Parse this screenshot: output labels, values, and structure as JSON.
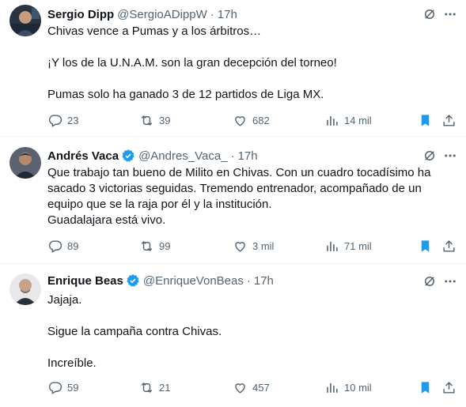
{
  "tweets": [
    {
      "name": "Sergio Dipp",
      "verified": false,
      "handle": "@SergioADippW",
      "dot": "·",
      "time": "17h",
      "lines": [
        "Chivas vence a Pumas y a los árbitros…",
        "",
        "¡Y los de la U.N.A.M. son la gran decepción del torneo!",
        "",
        "Pumas solo ha ganado 3 de 12 partidos de Liga MX."
      ],
      "replies": "23",
      "retweets": "39",
      "likes": "682",
      "views": "14 mil",
      "bookmarked": true
    },
    {
      "name": "Andrés Vaca",
      "verified": true,
      "handle": "@Andres_Vaca_",
      "dot": "·",
      "time": "17h",
      "lines": [
        "Que trabajo tan bueno de Milito en Chivas. Con un cuadro tocadísimo ha",
        "sacado 3 victorias seguidas. Tremendo entrenador, acompañado de un",
        "equipo que se la raja por él y la institución.",
        "Guadalajara está vivo."
      ],
      "replies": "89",
      "retweets": "99",
      "likes": "3 mil",
      "views": "71 mil",
      "bookmarked": true
    },
    {
      "name": "Enrique Beas",
      "verified": true,
      "handle": "@EnriqueVonBeas",
      "dot": "·",
      "time": "17h",
      "lines": [
        "Jajaja.",
        "",
        "Sigue la campaña contra Chivas.",
        "",
        "Increíble."
      ],
      "replies": "59",
      "retweets": "21",
      "likes": "457",
      "views": "10 mil",
      "bookmarked": true
    }
  ],
  "colors": {
    "text": "#0f1419",
    "secondary": "#536471",
    "accent": "#1d9bf0",
    "divider": "#eff3f4"
  }
}
